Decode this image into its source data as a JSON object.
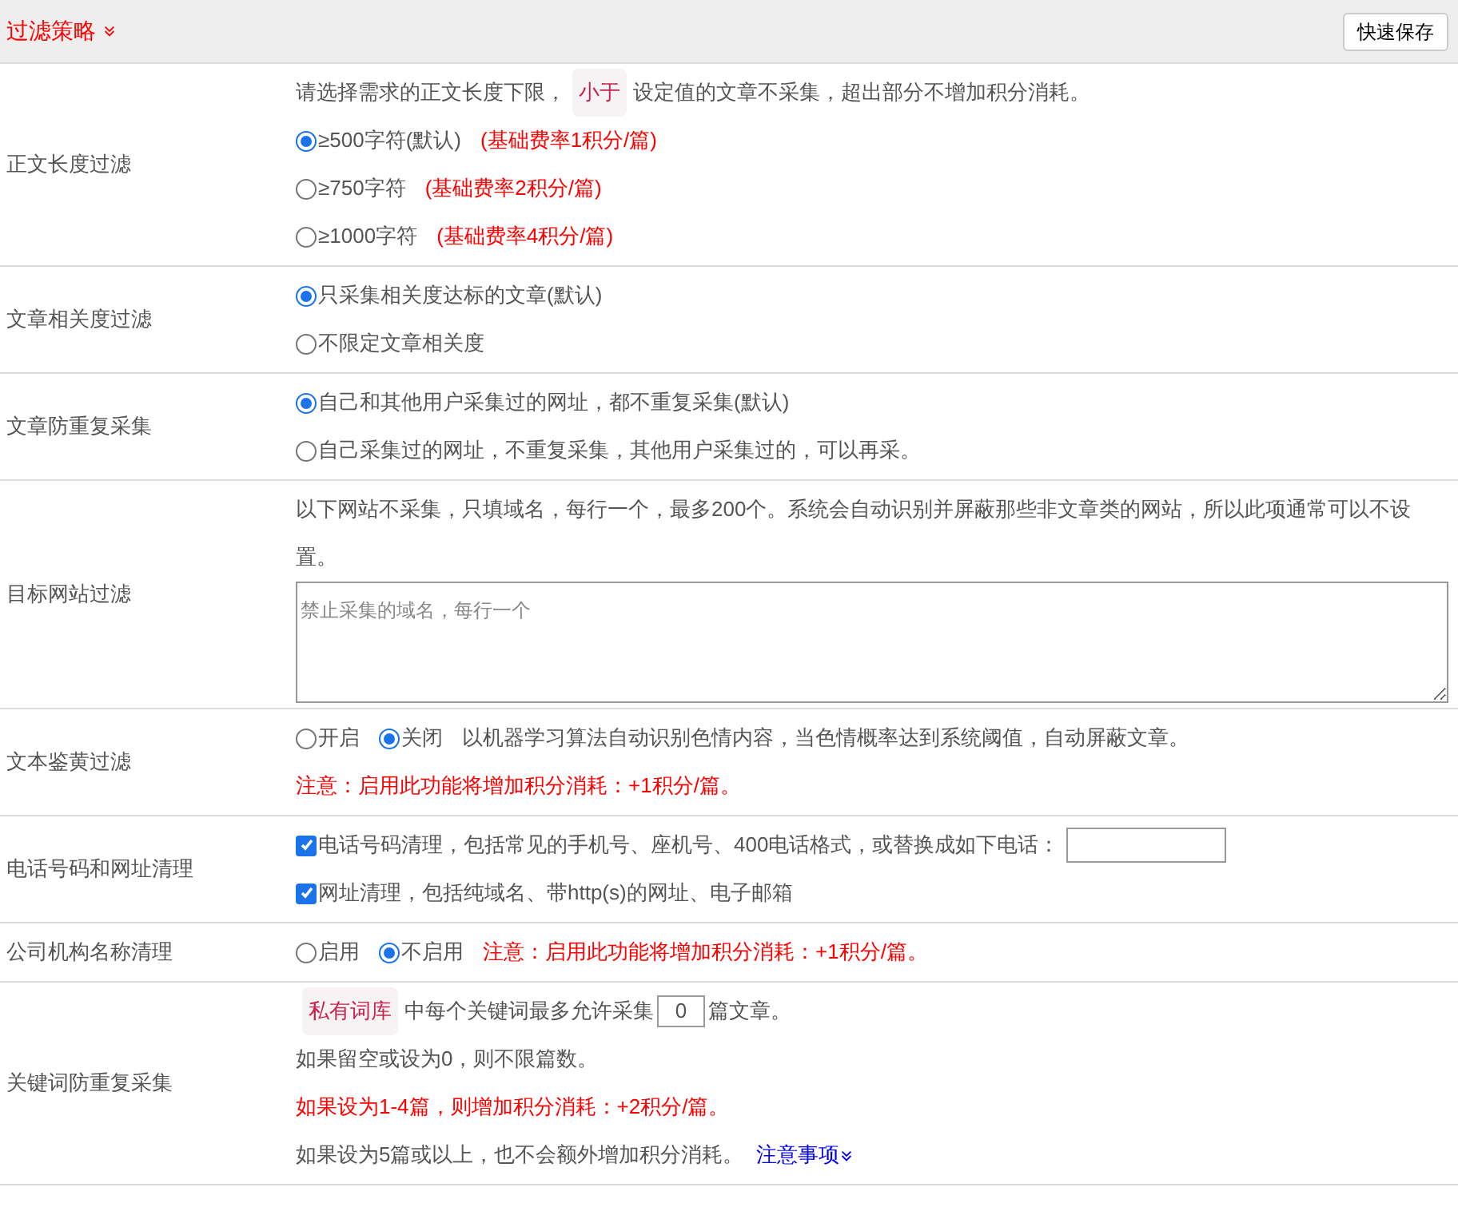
{
  "header": {
    "title": "过滤策略",
    "expanded": true,
    "save_button": "快速保存"
  },
  "sections": [
    {
      "label": "正文长度过滤",
      "lines": [
        [
          {
            "kind": "text",
            "text": "请选择需求的正文长度下限，"
          },
          {
            "kind": "tag",
            "text": "小于"
          },
          {
            "kind": "text",
            "text": "设定值的文章不采集，超出部分不增加积分消耗。"
          }
        ],
        [
          {
            "kind": "radio",
            "label": "≥500字符(默认)",
            "selected": true
          },
          {
            "kind": "warn",
            "text": "(基础费率1积分/篇)"
          }
        ],
        [
          {
            "kind": "radio",
            "label": "≥750字符",
            "selected": false
          },
          {
            "kind": "warn",
            "text": "(基础费率2积分/篇)"
          }
        ],
        [
          {
            "kind": "radio",
            "label": "≥1000字符",
            "selected": false
          },
          {
            "kind": "warn",
            "text": "(基础费率4积分/篇)"
          }
        ]
      ]
    },
    {
      "label": "文章相关度过滤",
      "lines": [
        [
          {
            "kind": "radio",
            "label": "只采集相关度达标的文章(默认)",
            "selected": true
          }
        ],
        [
          {
            "kind": "radio",
            "label": "不限定文章相关度",
            "selected": false
          }
        ]
      ]
    },
    {
      "label": "文章防重复采集",
      "lines": [
        [
          {
            "kind": "radio",
            "label": "自己和其他用户采集过的网址，都不重复采集(默认)",
            "selected": true
          }
        ],
        [
          {
            "kind": "radio",
            "label": "自己采集过的网址，不重复采集，其他用户采集过的，可以再采。",
            "selected": false
          }
        ]
      ]
    },
    {
      "label": "目标网站过滤",
      "lines": [
        [
          {
            "kind": "text",
            "text": "以下网站不采集，只填域名，每行一个，最多200个。系统会自动识别并屏蔽那些非文章类的网站，所以此项通常可以不设置。"
          }
        ],
        [
          {
            "kind": "textarea",
            "placeholder": "禁止采集的域名，每行一个"
          }
        ]
      ]
    },
    {
      "label": "文本鉴黄过滤",
      "lines": [
        [
          {
            "kind": "radio",
            "label": "开启",
            "selected": false
          },
          {
            "kind": "radio",
            "label": "关闭",
            "selected": true
          },
          {
            "kind": "text",
            "text": "以机器学习算法自动识别色情内容，当色情概率达到系统阈值，自动屏蔽文章。"
          }
        ],
        [
          {
            "kind": "warn",
            "text": "注意：启用此功能将增加积分消耗：+1积分/篇。"
          }
        ]
      ]
    },
    {
      "label": "电话号码和网址清理",
      "lines": [
        [
          {
            "kind": "checkbox",
            "label": "电话号码清理，包括常见的手机号、座机号、400电话格式，或替换成如下电话：",
            "checked": true
          },
          {
            "kind": "input"
          }
        ],
        [
          {
            "kind": "checkbox",
            "label": "网址清理，包括纯域名、带http(s)的网址、电子邮箱",
            "checked": true
          }
        ]
      ]
    },
    {
      "label": "公司机构名称清理",
      "lines": [
        [
          {
            "kind": "radio",
            "label": "启用",
            "selected": false
          },
          {
            "kind": "radio",
            "label": "不启用",
            "selected": true
          },
          {
            "kind": "warn",
            "text": "注意：启用此功能将增加积分消耗：+1积分/篇。"
          }
        ]
      ]
    },
    {
      "label": "关键词防重复采集",
      "lines": [
        [
          {
            "kind": "tag",
            "text": "私有词库"
          },
          {
            "kind": "text",
            "text": "中每个关键词最多允许采集"
          },
          {
            "kind": "number",
            "value": "0"
          },
          {
            "kind": "text",
            "text": "篇文章。"
          }
        ],
        [
          {
            "kind": "text",
            "text": "如果留空或设为0，则不限篇数。"
          }
        ],
        [
          {
            "kind": "warn",
            "text": "如果设为1-4篇，则增加积分消耗：+2积分/篇。"
          }
        ],
        [
          {
            "kind": "text",
            "text": "如果设为5篇或以上，也不会额外增加积分消耗。"
          },
          {
            "kind": "link",
            "text": "注意事项"
          }
        ]
      ]
    }
  ]
}
